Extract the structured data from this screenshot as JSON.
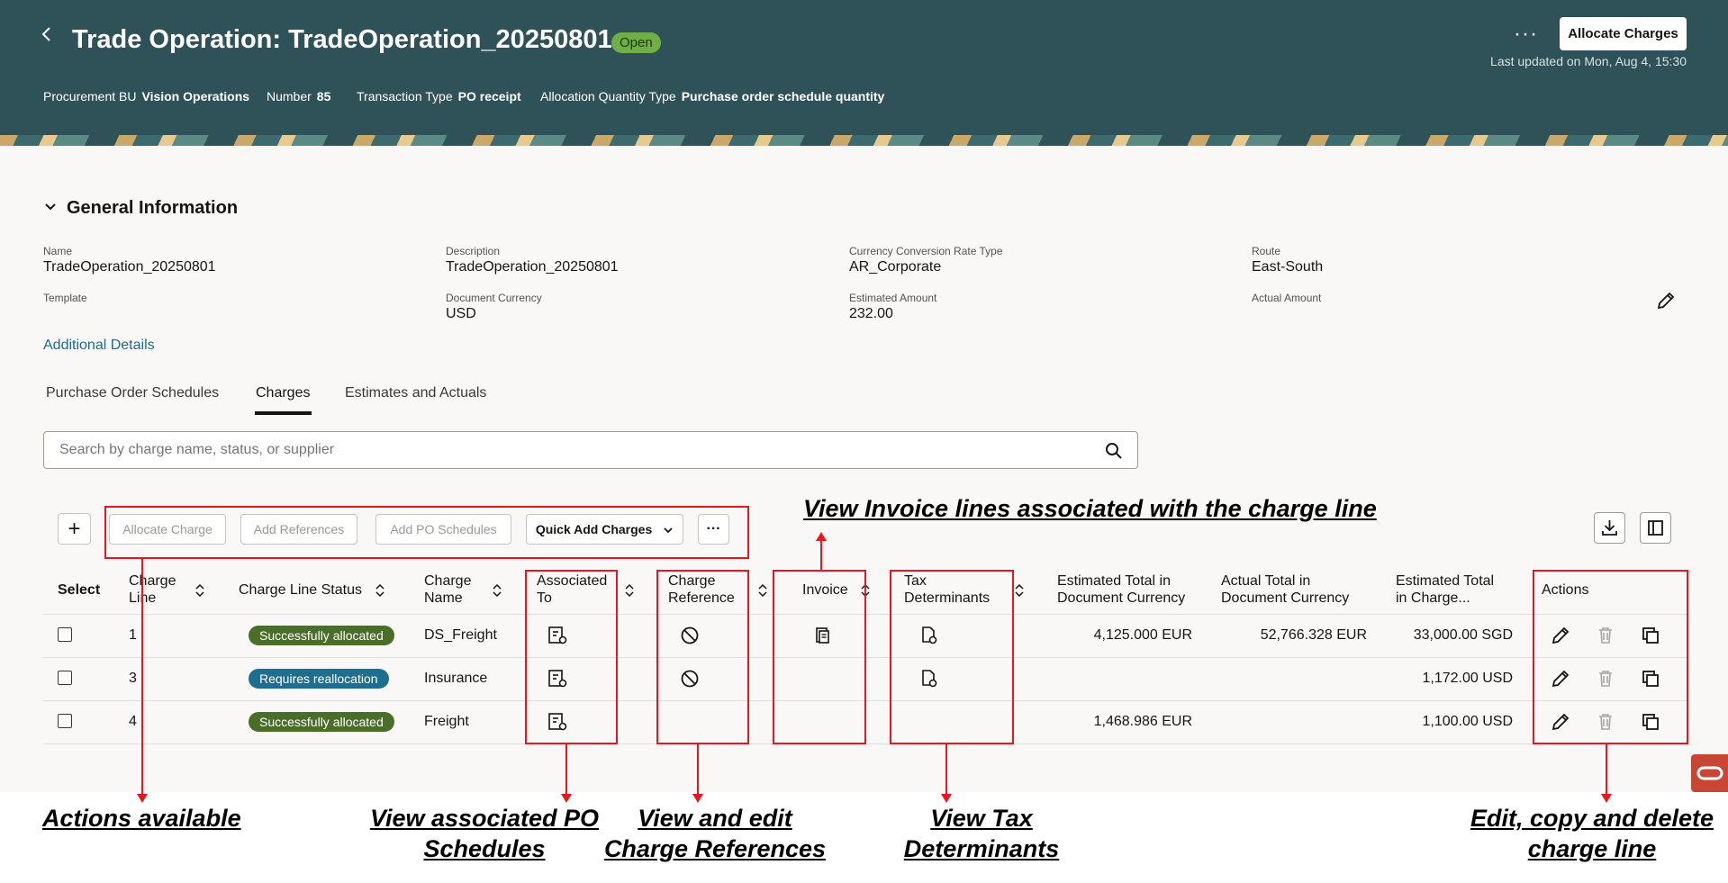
{
  "header": {
    "title": "Trade Operation: TradeOperation_20250801",
    "status": "Open",
    "more": "···",
    "allocate_button": "Allocate Charges",
    "last_updated": "Last updated on Mon, Aug 4, 15:30",
    "meta": [
      {
        "label": "Procurement BU",
        "value": "Vision Operations"
      },
      {
        "label": "Number",
        "value": "85"
      },
      {
        "label": "Transaction Type",
        "value": "PO receipt"
      },
      {
        "label": "Allocation Quantity Type",
        "value": "Purchase order schedule quantity"
      }
    ]
  },
  "general": {
    "title": "General Information",
    "fields": {
      "name": {
        "label": "Name",
        "value": "TradeOperation_20250801"
      },
      "description": {
        "label": "Description",
        "value": "TradeOperation_20250801"
      },
      "rate_type": {
        "label": "Currency Conversion Rate Type",
        "value": "AR_Corporate"
      },
      "route": {
        "label": "Route",
        "value": "East-South"
      },
      "template": {
        "label": "Template",
        "value": ""
      },
      "doc_currency": {
        "label": "Document Currency",
        "value": "USD"
      },
      "est_amount": {
        "label": "Estimated Amount",
        "value": "232.00"
      },
      "actual_amount": {
        "label": "Actual Amount",
        "value": ""
      }
    },
    "additional_details": "Additional Details"
  },
  "tabs": [
    "Purchase Order Schedules",
    "Charges",
    "Estimates and Actuals"
  ],
  "active_tab": "Charges",
  "search": {
    "placeholder": "Search by charge name, status, or supplier"
  },
  "toolbar": {
    "add": "+",
    "allocate_charge": "Allocate Charge",
    "add_references": "Add References",
    "add_po_schedules": "Add PO Schedules",
    "quick_add": "Quick Add Charges",
    "more": "···"
  },
  "columns": {
    "select": "Select",
    "charge_line_1": "Charge",
    "charge_line_2": "Line",
    "status": "Charge Line Status",
    "charge_name_1": "Charge",
    "charge_name_2": "Name",
    "assoc_1": "Associated",
    "assoc_2": "To",
    "ref_1": "Charge",
    "ref_2": "Reference",
    "invoice": "Invoice",
    "tax_1": "Tax",
    "tax_2": "Determinants",
    "est_doc_1": "Estimated Total in",
    "est_doc_2": "Document Currency",
    "act_doc_1": "Actual Total in",
    "act_doc_2": "Document Currency",
    "est_chg_1": "Estimated Total",
    "est_chg_2": "in Charge...",
    "actions": "Actions"
  },
  "rows": [
    {
      "line": "1",
      "status": "Successfully allocated",
      "status_kind": "ok",
      "name": "DS_Freight",
      "est_doc": "4,125.000 EUR",
      "act_doc": "52,766.328 EUR",
      "est_chg": "33,000.00 SGD"
    },
    {
      "line": "3",
      "status": "Requires reallocation",
      "status_kind": "req",
      "name": "Insurance",
      "est_doc": "",
      "act_doc": "",
      "est_chg": "1,172.00 USD"
    },
    {
      "line": "4",
      "status": "Successfully allocated",
      "status_kind": "ok",
      "name": "Freight",
      "est_doc": "1,468.986 EUR",
      "act_doc": "",
      "est_chg": "1,100.00 USD"
    }
  ],
  "callouts": {
    "invoice": "View Invoice lines associated with the charge line",
    "actions_available": "Actions available",
    "po_schedules_1": "View associated PO",
    "po_schedules_2": "Schedules",
    "charge_refs_1": "View and edit",
    "charge_refs_2": "Charge References",
    "tax_1": "View Tax",
    "tax_2": "Determinants",
    "edit_1": "Edit, copy and delete",
    "edit_2": "charge line"
  },
  "colors": {
    "header_bg": "#2f5258",
    "status_ok": "#4b6d2a",
    "status_req": "#1e6f8f",
    "callout_red": "#e8161d",
    "link": "#1e6b8a"
  }
}
